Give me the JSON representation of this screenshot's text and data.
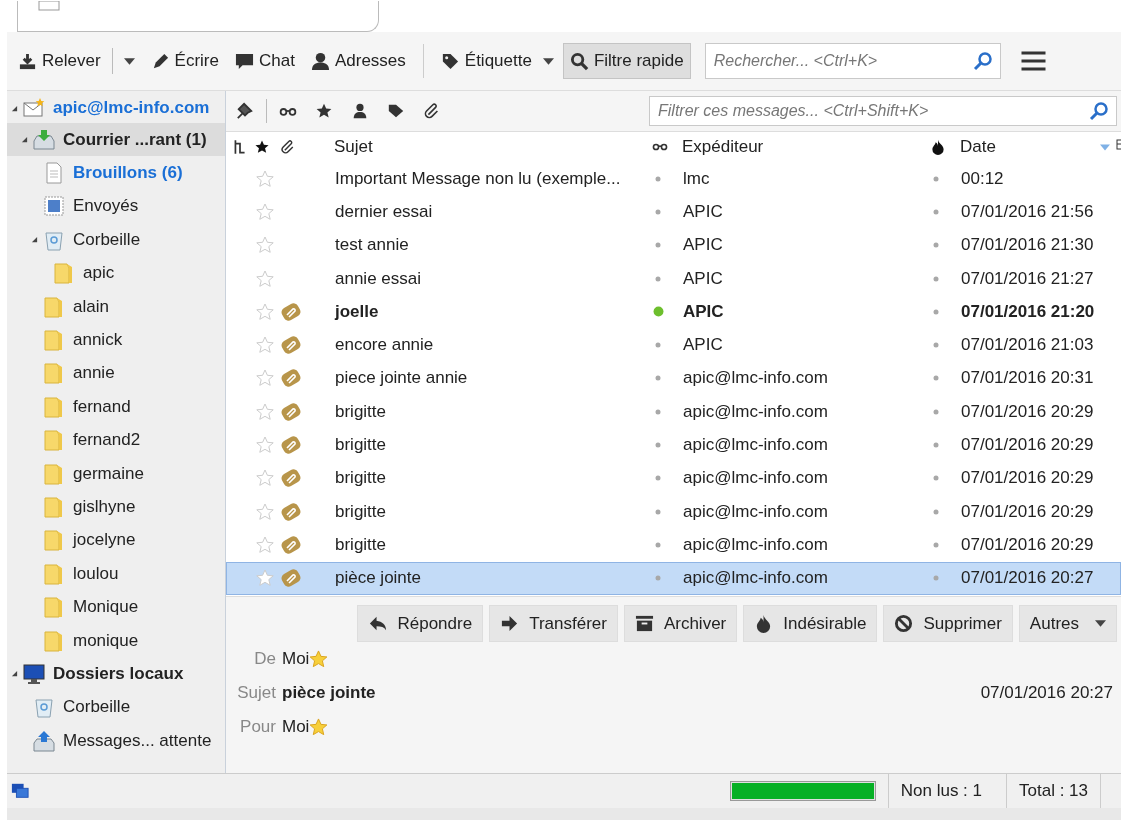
{
  "toolbar": {
    "buttons": [
      {
        "label": "Relever",
        "kind": "split"
      },
      {
        "label": "Écrire",
        "kind": "plain"
      },
      {
        "label": "Chat",
        "kind": "plain"
      },
      {
        "label": "Adresses",
        "kind": "plain"
      },
      {
        "label": "Étiquette",
        "kind": "menu"
      }
    ],
    "quick_filter": {
      "label": "Filtre rapide",
      "selected": true
    },
    "search": {
      "placeholder": "Rechercher... <Ctrl+K>"
    }
  },
  "folders": [
    {
      "label": "apic@lmc-info.com",
      "kind": "account",
      "expanded": true,
      "selected": false,
      "unread": true,
      "new": true,
      "children": [
        {
          "label": "Courrier ...rant (1)",
          "kind": "inbox",
          "expanded": true,
          "selected": true,
          "unread": true,
          "new": false,
          "children": [
            {
              "label": "Brouillons (6)",
              "kind": "drafts",
              "selected": false,
              "unread": true,
              "new": true
            },
            {
              "label": "Envoyés",
              "kind": "sent",
              "selected": false,
              "unread": false,
              "new": false
            },
            {
              "label": "Corbeille",
              "kind": "trash",
              "expanded": true,
              "selected": false,
              "unread": false,
              "new": false,
              "children": [
                {
                  "label": "apic",
                  "kind": "folder",
                  "selected": false,
                  "unread": false,
                  "new": false
                }
              ]
            },
            {
              "label": "alain",
              "kind": "folder",
              "selected": false,
              "unread": false,
              "new": false
            },
            {
              "label": "annick",
              "kind": "folder",
              "selected": false,
              "unread": false,
              "new": false
            },
            {
              "label": "annie",
              "kind": "folder",
              "selected": false,
              "unread": false,
              "new": false
            },
            {
              "label": "fernand",
              "kind": "folder",
              "selected": false,
              "unread": false,
              "new": false
            },
            {
              "label": "fernand2",
              "kind": "folder",
              "selected": false,
              "unread": false,
              "new": false
            },
            {
              "label": "germaine",
              "kind": "folder",
              "selected": false,
              "unread": false,
              "new": false
            },
            {
              "label": "gislhyne",
              "kind": "folder",
              "selected": false,
              "unread": false,
              "new": false
            },
            {
              "label": "jocelyne",
              "kind": "folder",
              "selected": false,
              "unread": false,
              "new": false
            },
            {
              "label": "loulou",
              "kind": "folder",
              "selected": false,
              "unread": false,
              "new": false
            },
            {
              "label": "Monique",
              "kind": "folder",
              "selected": false,
              "unread": false,
              "new": false
            },
            {
              "label": "monique",
              "kind": "folder",
              "selected": false,
              "unread": false,
              "new": false
            }
          ]
        }
      ]
    },
    {
      "label": "Dossiers locaux",
      "kind": "local",
      "expanded": true,
      "selected": false,
      "unread": true,
      "new": false,
      "children": [
        {
          "label": "Corbeille",
          "kind": "trash",
          "selected": false,
          "unread": false,
          "new": false
        },
        {
          "label": "Messages... attente",
          "kind": "outbox",
          "selected": false,
          "unread": false,
          "new": false
        }
      ]
    }
  ],
  "filter": {
    "placeholder": "Filtrer ces messages... <Ctrl+Shift+K>"
  },
  "columns": {
    "subject": "Sujet",
    "sender": "Expéditeur",
    "date": "Date"
  },
  "messages": [
    {
      "subject": "Important Message non lu (exemple...",
      "sender": "lmc",
      "date": "00:12",
      "starred": false,
      "attachment": false,
      "unread": false,
      "selected": false
    },
    {
      "subject": "dernier essai",
      "sender": "APIC",
      "date": "07/01/2016 21:56",
      "starred": false,
      "attachment": false,
      "unread": false,
      "selected": false
    },
    {
      "subject": "test annie",
      "sender": "APIC",
      "date": "07/01/2016 21:30",
      "starred": false,
      "attachment": false,
      "unread": false,
      "selected": false
    },
    {
      "subject": "annie essai",
      "sender": "APIC",
      "date": "07/01/2016 21:27",
      "starred": false,
      "attachment": false,
      "unread": false,
      "selected": false
    },
    {
      "subject": "joelle",
      "sender": "APIC",
      "date": "07/01/2016 21:20",
      "starred": false,
      "attachment": true,
      "unread": true,
      "selected": false
    },
    {
      "subject": "encore annie",
      "sender": "APIC",
      "date": "07/01/2016 21:03",
      "starred": false,
      "attachment": true,
      "unread": false,
      "selected": false
    },
    {
      "subject": "piece jointe annie",
      "sender": "apic@lmc-info.com",
      "date": "07/01/2016 20:31",
      "starred": false,
      "attachment": true,
      "unread": false,
      "selected": false
    },
    {
      "subject": "brigitte",
      "sender": "apic@lmc-info.com",
      "date": "07/01/2016 20:29",
      "starred": false,
      "attachment": true,
      "unread": false,
      "selected": false
    },
    {
      "subject": "brigitte",
      "sender": "apic@lmc-info.com",
      "date": "07/01/2016 20:29",
      "starred": false,
      "attachment": true,
      "unread": false,
      "selected": false
    },
    {
      "subject": "brigitte",
      "sender": "apic@lmc-info.com",
      "date": "07/01/2016 20:29",
      "starred": false,
      "attachment": true,
      "unread": false,
      "selected": false
    },
    {
      "subject": "brigitte",
      "sender": "apic@lmc-info.com",
      "date": "07/01/2016 20:29",
      "starred": false,
      "attachment": true,
      "unread": false,
      "selected": false
    },
    {
      "subject": "brigitte",
      "sender": "apic@lmc-info.com",
      "date": "07/01/2016 20:29",
      "starred": false,
      "attachment": true,
      "unread": false,
      "selected": false
    },
    {
      "subject": "pièce jointe",
      "sender": "apic@lmc-info.com",
      "date": "07/01/2016 20:27",
      "starred": false,
      "attachment": true,
      "unread": false,
      "selected": true
    }
  ],
  "preview": {
    "buttons": [
      {
        "label": "Répondre",
        "kind": "plain"
      },
      {
        "label": "Transférer",
        "kind": "plain"
      },
      {
        "label": "Archiver",
        "kind": "plain"
      },
      {
        "label": "Indésirable",
        "kind": "plain"
      },
      {
        "label": "Supprimer",
        "kind": "plain"
      },
      {
        "label": "Autres",
        "kind": "menu"
      }
    ],
    "headers": [
      {
        "label": "De",
        "value": "Moi",
        "kind": "contact"
      },
      {
        "label": "Sujet",
        "value": "pièce jointe",
        "kind": "subject",
        "date": "07/01/2016 20:27"
      },
      {
        "label": "Pour",
        "value": "Moi",
        "kind": "contact"
      }
    ]
  },
  "status_bar": {
    "progress": {
      "level": 1
    },
    "unread": "Non lus : 1",
    "total": "Total : 13"
  }
}
